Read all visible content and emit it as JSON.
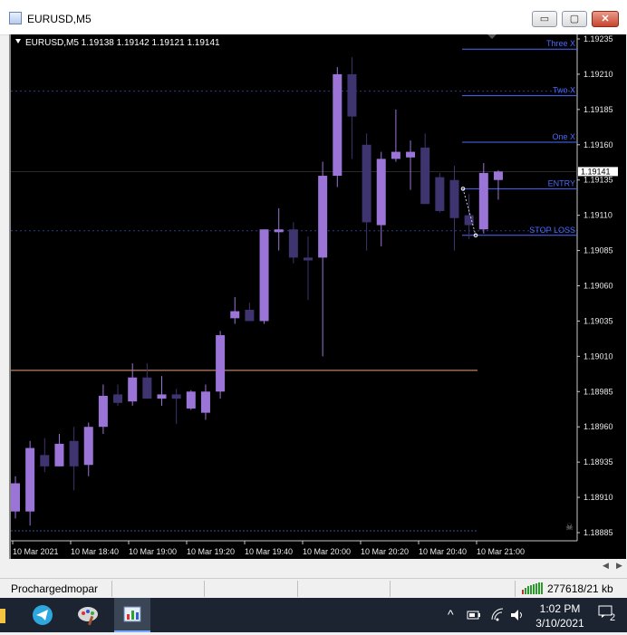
{
  "window": {
    "title": "EURUSD,M5",
    "minimize_glyph": "▭",
    "maximize_glyph": "▢",
    "close_glyph": "✕"
  },
  "chart_header": "EURUSD,M5  1.19138 1.19142 1.19121 1.19141",
  "chart_data": {
    "type": "candlestick",
    "symbol": "EURUSD",
    "timeframe": "M5",
    "ylim": [
      1.18885,
      1.19235
    ],
    "y_ticks": [
      "1.19235",
      "1.19210",
      "1.19185",
      "1.19160",
      "1.19135",
      "1.19110",
      "1.19085",
      "1.19060",
      "1.19035",
      "1.19010",
      "1.18985",
      "1.18960",
      "1.18935",
      "1.18910",
      "1.18885"
    ],
    "x_ticks": [
      "10 Mar 2021",
      "10 Mar 18:40",
      "10 Mar 19:00",
      "10 Mar 19:20",
      "10 Mar 19:40",
      "10 Mar 20:00",
      "10 Mar 20:20",
      "10 Mar 20:40",
      "10 Mar 21:00"
    ],
    "bull_color": "#9b74d8",
    "bear_color": "#3e3470",
    "candles": [
      {
        "o": 1.189,
        "h": 1.18925,
        "l": 1.18895,
        "c": 1.1892
      },
      {
        "o": 1.189,
        "h": 1.1895,
        "l": 1.1889,
        "c": 1.18945
      },
      {
        "o": 1.1894,
        "h": 1.18952,
        "l": 1.18928,
        "c": 1.18932
      },
      {
        "o": 1.18932,
        "h": 1.18955,
        "l": 1.18932,
        "c": 1.18948
      },
      {
        "o": 1.1895,
        "h": 1.1896,
        "l": 1.18915,
        "c": 1.18932
      },
      {
        "o": 1.18933,
        "h": 1.18963,
        "l": 1.18925,
        "c": 1.1896
      },
      {
        "o": 1.1896,
        "h": 1.1899,
        "l": 1.18955,
        "c": 1.18982
      },
      {
        "o": 1.18983,
        "h": 1.1899,
        "l": 1.18975,
        "c": 1.18977
      },
      {
        "o": 1.18978,
        "h": 1.19005,
        "l": 1.18975,
        "c": 1.18995
      },
      {
        "o": 1.18995,
        "h": 1.19005,
        "l": 1.18985,
        "c": 1.1898
      },
      {
        "o": 1.1898,
        "h": 1.18996,
        "l": 1.18975,
        "c": 1.18983
      },
      {
        "o": 1.18983,
        "h": 1.18987,
        "l": 1.18962,
        "c": 1.1898
      },
      {
        "o": 1.18973,
        "h": 1.18986,
        "l": 1.18972,
        "c": 1.18985
      },
      {
        "o": 1.1897,
        "h": 1.1899,
        "l": 1.18965,
        "c": 1.18985
      },
      {
        "o": 1.18985,
        "h": 1.19028,
        "l": 1.1898,
        "c": 1.19025
      },
      {
        "o": 1.19037,
        "h": 1.19052,
        "l": 1.19033,
        "c": 1.19042
      },
      {
        "o": 1.19043,
        "h": 1.19048,
        "l": 1.19035,
        "c": 1.19035
      },
      {
        "o": 1.19035,
        "h": 1.191,
        "l": 1.19033,
        "c": 1.191
      },
      {
        "o": 1.19098,
        "h": 1.19115,
        "l": 1.19085,
        "c": 1.191
      },
      {
        "o": 1.191,
        "h": 1.19105,
        "l": 1.19076,
        "c": 1.1908
      },
      {
        "o": 1.1908,
        "h": 1.19095,
        "l": 1.1905,
        "c": 1.19078
      },
      {
        "o": 1.1908,
        "h": 1.19148,
        "l": 1.1901,
        "c": 1.19138
      },
      {
        "o": 1.19138,
        "h": 1.19215,
        "l": 1.1913,
        "c": 1.1921
      },
      {
        "o": 1.1921,
        "h": 1.19222,
        "l": 1.1915,
        "c": 1.1918
      },
      {
        "o": 1.1916,
        "h": 1.19168,
        "l": 1.19085,
        "c": 1.19105
      },
      {
        "o": 1.19103,
        "h": 1.19155,
        "l": 1.19088,
        "c": 1.1915
      },
      {
        "o": 1.1915,
        "h": 1.19185,
        "l": 1.19148,
        "c": 1.19155
      },
      {
        "o": 1.19151,
        "h": 1.19163,
        "l": 1.19128,
        "c": 1.19155
      },
      {
        "o": 1.19158,
        "h": 1.19168,
        "l": 1.1912,
        "c": 1.19118
      },
      {
        "o": 1.19137,
        "h": 1.1914,
        "l": 1.19112,
        "c": 1.19113
      },
      {
        "o": 1.19135,
        "h": 1.19145,
        "l": 1.19085,
        "c": 1.19108
      },
      {
        "o": 1.1911,
        "h": 1.19125,
        "l": 1.19093,
        "c": 1.19103
      },
      {
        "o": 1.191,
        "h": 1.19147,
        "l": 1.19097,
        "c": 1.1914
      },
      {
        "o": 1.19135,
        "h": 1.19142,
        "l": 1.19121,
        "c": 1.19141
      }
    ],
    "levels": [
      {
        "label": "Three X",
        "price": 1.19231
      },
      {
        "label": "Two X",
        "price": 1.19198
      },
      {
        "label": "One X",
        "price": 1.19165
      },
      {
        "label": "ENTRY",
        "price": 1.19132
      },
      {
        "label": "STOP LOSS",
        "price": 1.19099
      }
    ],
    "last_price": "1.19141",
    "level_color": "#4a6aff",
    "support_price": 1.19,
    "support_color": "#e8a080"
  },
  "status": {
    "user": "Prochargedmopar",
    "traffic": "277618/21 kb"
  },
  "taskbar": {
    "time": "1:02 PM",
    "date": "3/10/2021",
    "notification_count": "2",
    "tray_chevron": "^"
  }
}
